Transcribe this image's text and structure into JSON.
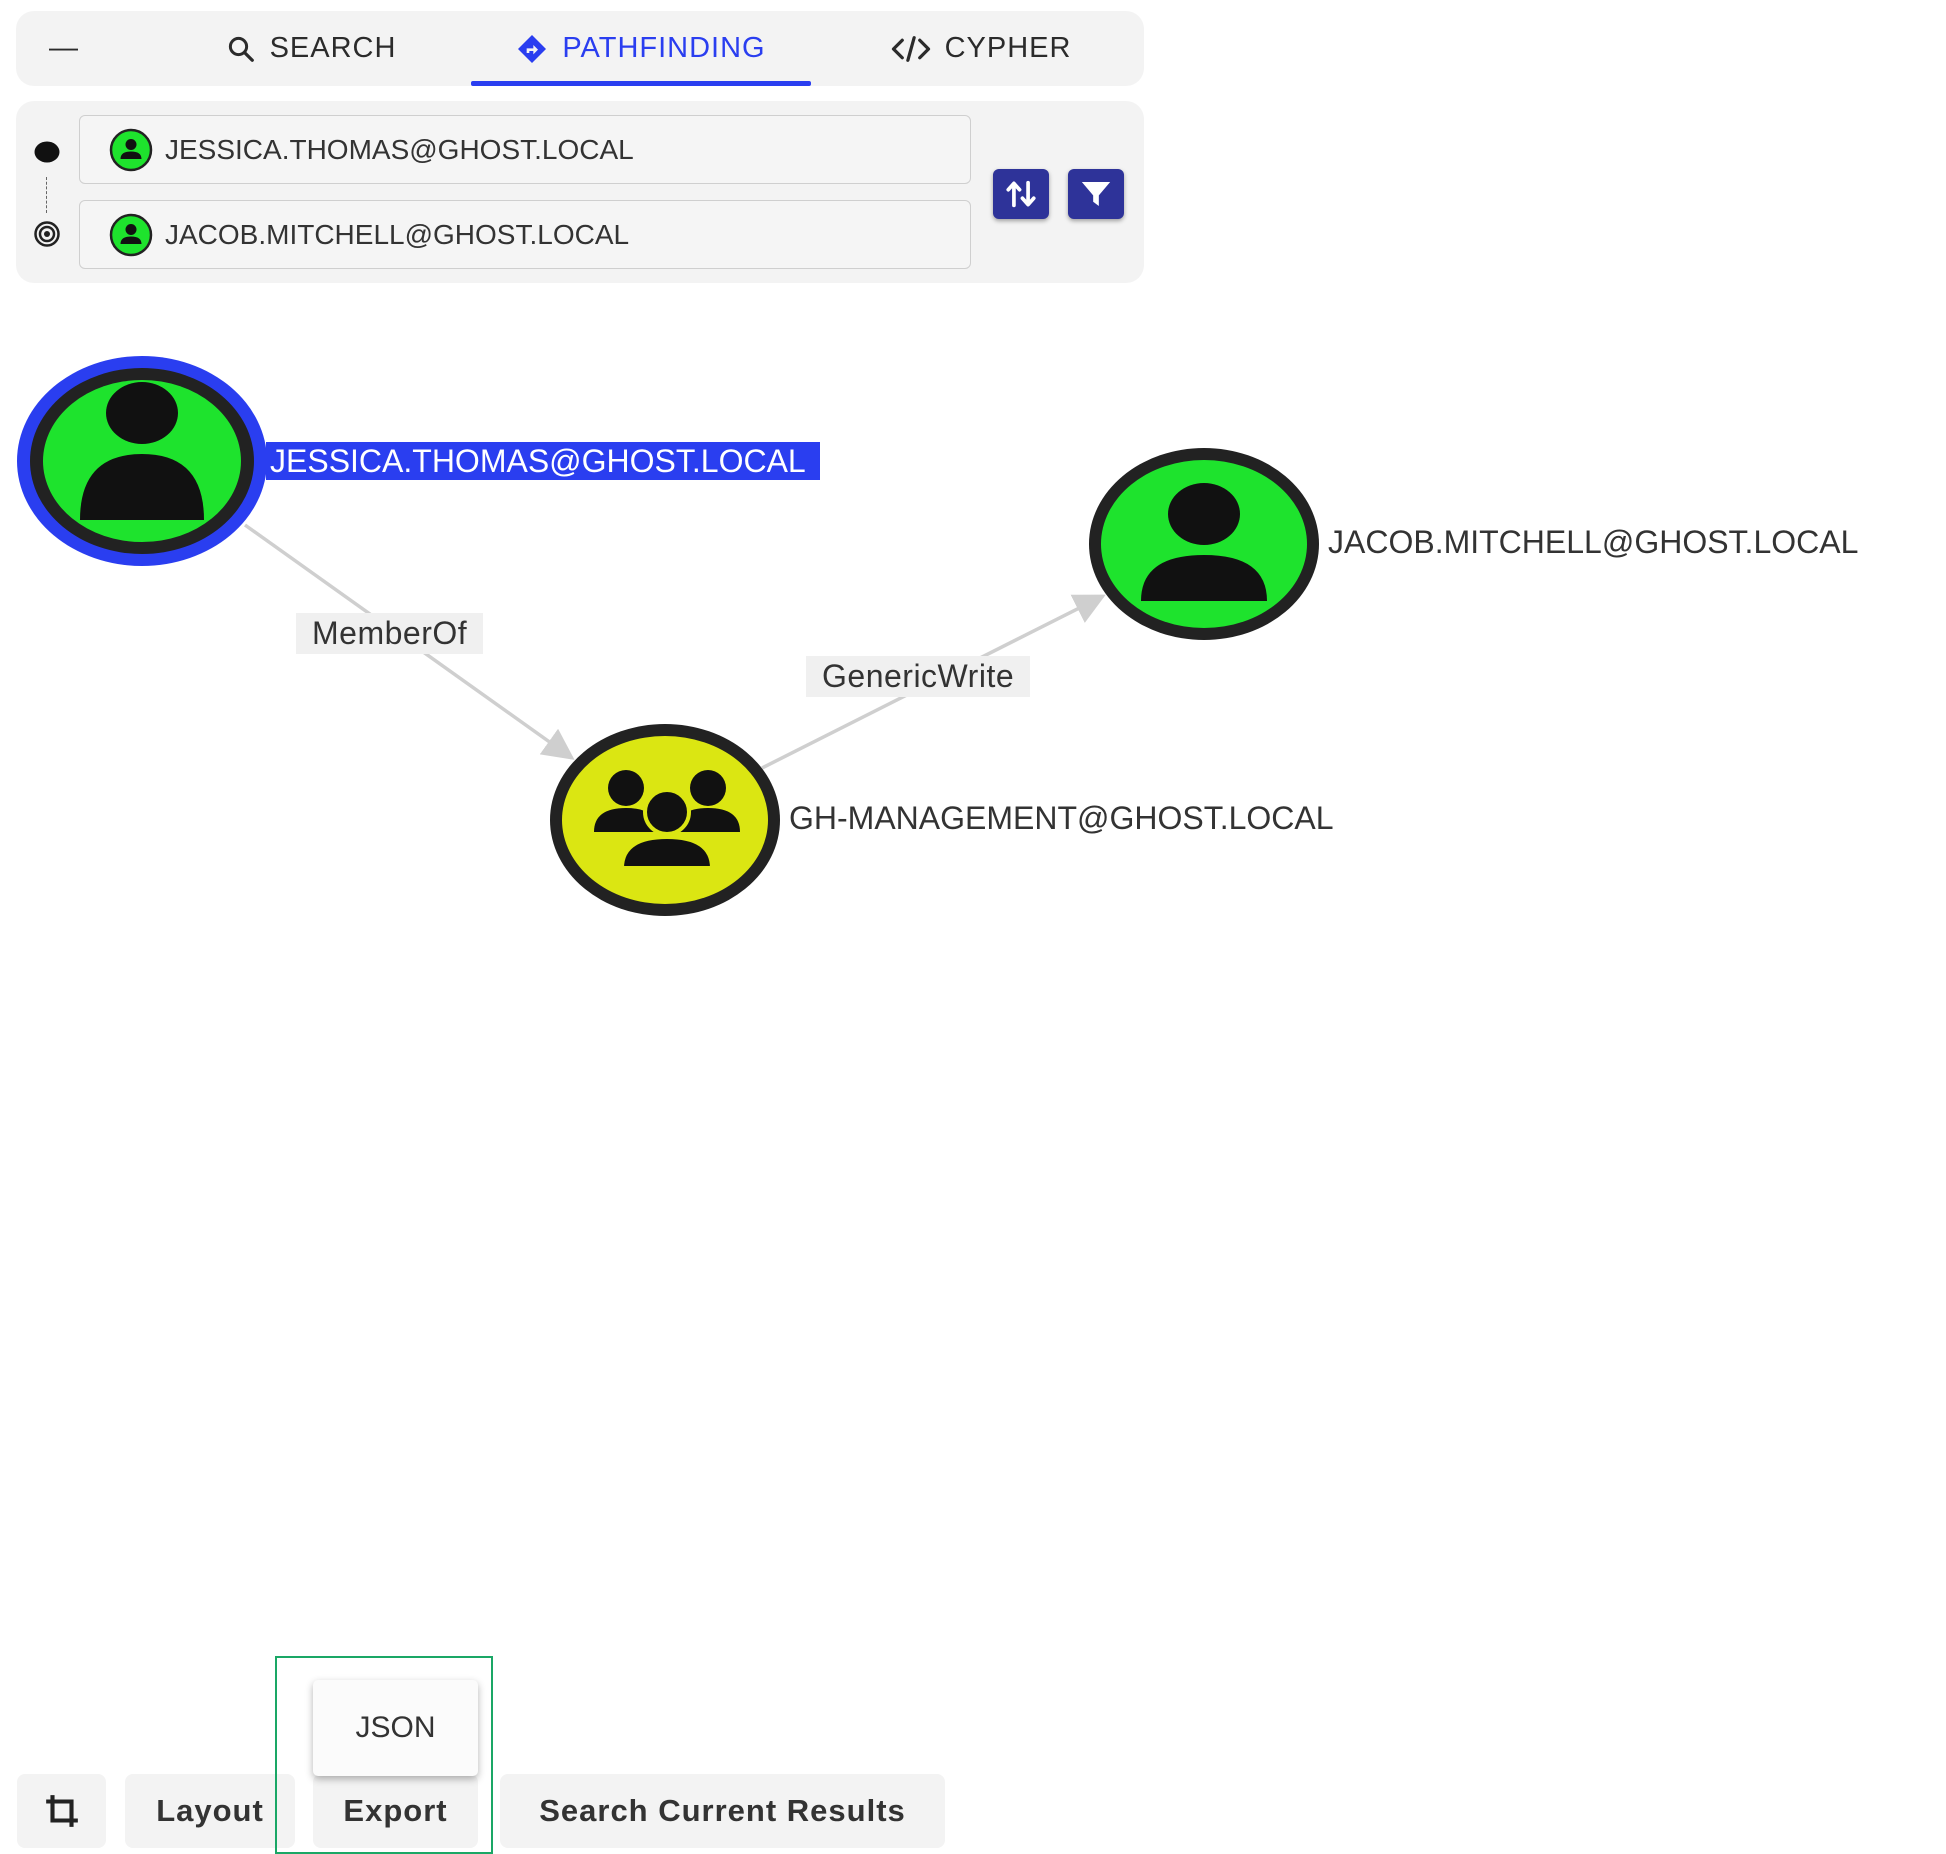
{
  "tabs": {
    "collapse_label": "—",
    "search_label": "SEARCH",
    "pathfinding_label": "PATHFINDING",
    "cypher_label": "CYPHER"
  },
  "pathfinding": {
    "start_node": "JESSICA.THOMAS@GHOST.LOCAL",
    "end_node": "JACOB.MITCHELL@GHOST.LOCAL"
  },
  "graph": {
    "nodes": [
      {
        "label": "JESSICA.THOMAS@GHOST.LOCAL",
        "type": "user",
        "selected": true
      },
      {
        "label": "JACOB.MITCHELL@GHOST.LOCAL",
        "type": "user",
        "selected": false
      },
      {
        "label": "GH-MANAGEMENT@GHOST.LOCAL",
        "type": "group",
        "selected": false
      }
    ],
    "edges": [
      {
        "label": "MemberOf"
      },
      {
        "label": "GenericWrite"
      }
    ]
  },
  "toolbar": {
    "layout_label": "Layout",
    "export_label": "Export",
    "search_results_label": "Search Current Results",
    "export_menu_item": "JSON"
  },
  "colors": {
    "accent": "#2a3ef0",
    "user_node": "#1ee32d",
    "group_node": "#dbe612",
    "button": "#2e3399",
    "highlight": "#1aa766"
  }
}
